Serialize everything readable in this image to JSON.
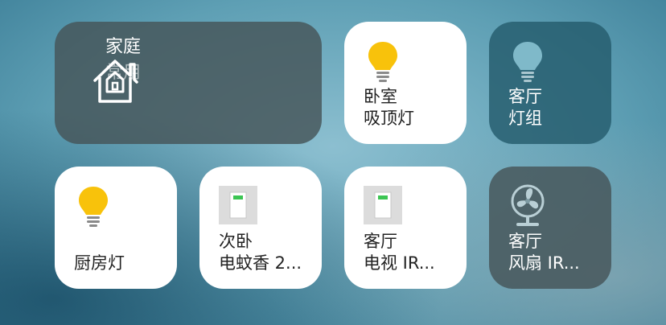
{
  "scene": {
    "title": "家庭",
    "subtitle": "常用",
    "icon": "home-icon"
  },
  "tiles": [
    {
      "line1": "卧室",
      "line2": "吸顶灯",
      "icon": "bulb-on-icon",
      "state": "on"
    },
    {
      "line1": "客厅",
      "line2": "灯组",
      "icon": "bulb-off-icon",
      "state": "off"
    },
    {
      "line1": "厨房灯",
      "line2": "",
      "icon": "bulb-on-icon",
      "state": "on"
    },
    {
      "line1": "次卧",
      "line2": "电蚊香 2...",
      "icon": "switch-icon",
      "state": "on"
    },
    {
      "line1": "客厅",
      "line2": "电视 IR...",
      "icon": "switch-icon",
      "state": "on"
    },
    {
      "line1": "客厅",
      "line2": "风扇 IR...",
      "icon": "fan-icon",
      "state": "off"
    }
  ],
  "colors": {
    "bulb_on": "#f8c20b",
    "bulb_off": "#7fb9c9",
    "switch_indicator": "#3cc553"
  }
}
